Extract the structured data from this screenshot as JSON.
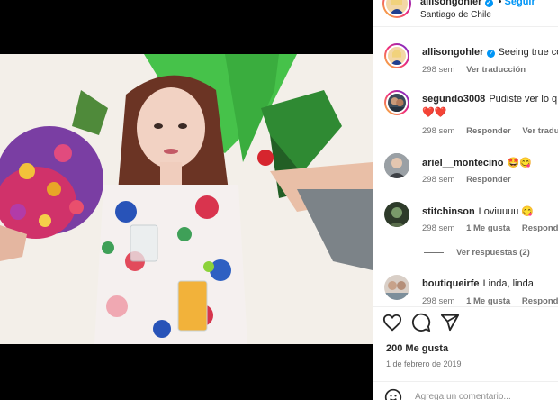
{
  "post": {
    "username": "allisongohler",
    "separator": "•",
    "follow_label": "Seguir",
    "location": "Santiago de Chile"
  },
  "comments": [
    {
      "user": "allisongohler",
      "text": "Seeing true co",
      "age": "298 sem",
      "action": "Ver traducción"
    },
    {
      "user": "segundo3008",
      "text": "Pudiste ver lo q",
      "text2": "❤️❤️",
      "age": "298 sem",
      "reply": "Responder",
      "translate": "Ver traduc"
    },
    {
      "user": "ariel__montecino",
      "text": "🤩😋",
      "age": "298 sem",
      "reply": "Responder"
    },
    {
      "user": "stitchinson",
      "text": "Loviuuuu 😋",
      "age": "298 sem",
      "likes": "1 Me gusta",
      "reply": "Responder"
    },
    {
      "user": "boutiqueirfe",
      "text": "Linda, linda",
      "age": "298 sem",
      "likes": "1 Me gusta",
      "reply": "Responder"
    }
  ],
  "view_replies": "Ver respuestas (2)",
  "footer": {
    "likes": "200 Me gusta",
    "date": "1 de febrero de 2019",
    "comment_placeholder": "Agrega un comentario..."
  },
  "icons": [
    "heart-icon",
    "comment-icon",
    "share-icon",
    "emoji-icon",
    "verified-badge-icon"
  ],
  "colors": {
    "link": "#0095f6",
    "text": "#262626",
    "muted": "#737373",
    "like_red": "#ed4956"
  }
}
